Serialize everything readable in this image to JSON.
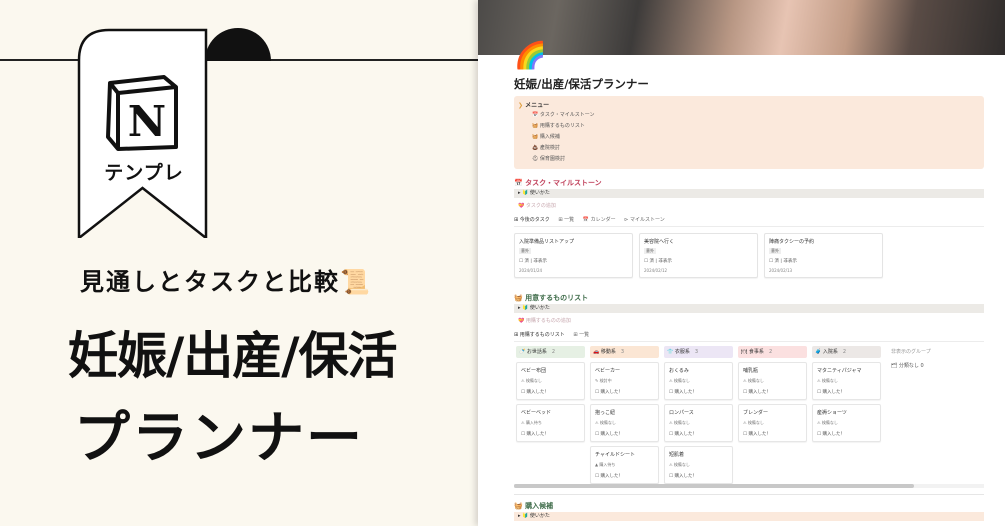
{
  "banner": {
    "logo_letter": "N",
    "ribbon_label": "テンプレ",
    "subtitle": "見通しとタスクと比較📜",
    "title_line1": "妊娠/出産/保活",
    "title_line2": "プランナー"
  },
  "notion": {
    "page_icon": "🌈",
    "page_title": "妊娠/出産/保活プランナー",
    "menu": {
      "title": "メニュー",
      "items": [
        "📅 タスク・マイルストーン",
        "🧺 用購するものリスト",
        "🧺 購入候補",
        "💩 產院検討",
        "⛑ 保育園検討"
      ]
    },
    "tasks": {
      "heading": "📅 タスク・マイルストーン",
      "toggle": "▸ 🔰 使いかた",
      "add_label": "💝 タスクの追加",
      "tabs": [
        "⊞ 今後のタスク",
        "⊞ 一覧",
        "📅 カレンダー",
        "⊳ マイルストーン"
      ],
      "cards": [
        {
          "title": "入院準備品リストアップ",
          "status": "意外",
          "check": "☐ 済 | 非表示",
          "date": "2024/01/24"
        },
        {
          "title": "美容院へ行く",
          "status": "意外",
          "check": "☐ 済 | 非表示",
          "date": "2024/02/12"
        },
        {
          "title": "陣痛タクシーの予約",
          "status": "意外",
          "check": "☐ 済 | 非表示",
          "date": "2024/02/13"
        }
      ]
    },
    "shopping": {
      "heading": "🧺 用意するものリスト",
      "toggle": "▸ 🔰 使いかた",
      "add_label": "💝 用購するものの追加",
      "tabs": [
        "⊞ 用購するものリスト",
        "⊞ 一覧"
      ],
      "columns": [
        {
          "label": "🍼 お世話系",
          "count": "2",
          "color": "#e6f0e4",
          "items": [
            {
              "title": "ベビー布団",
              "status": "⚠ 検備なし",
              "check": "☐ 購入した！"
            },
            {
              "title": "ベビーベッド",
              "status": "⚠ 購入待ち",
              "check": "☐ 購入した！"
            }
          ]
        },
        {
          "label": "🚗 移動系",
          "count": "3",
          "color": "#fbe6d4",
          "items": [
            {
              "title": "ベビーカー",
              "status": "✎ 検討中",
              "check": "☐ 購入した！"
            },
            {
              "title": "抱っこ紐",
              "status": "⚠ 検備なし",
              "check": "☐ 購入した！"
            },
            {
              "title": "チャイルドシート",
              "status": "▲ 購入待ち",
              "check": "☐ 購入した！"
            }
          ]
        },
        {
          "label": "👕 衣服系",
          "count": "3",
          "color": "#ece6f5",
          "items": [
            {
              "title": "おくるみ",
              "status": "⚠ 検備なし",
              "check": "☐ 購入した！"
            },
            {
              "title": "ロンパース",
              "status": "⚠ 検備なし",
              "check": "☐ 購入した！"
            },
            {
              "title": "短肌着",
              "status": "⚠ 検備なし",
              "check": "☐ 購入した！"
            }
          ]
        },
        {
          "label": "🍽 食事系",
          "count": "2",
          "color": "#fbe0e0",
          "items": [
            {
              "title": "哺乳瓶",
              "status": "⚠ 検備なし",
              "check": "☐ 購入した！"
            },
            {
              "title": "ブレンダー",
              "status": "⚠ 検備なし",
              "check": "☐ 購入した！"
            }
          ]
        },
        {
          "label": "🧳 入院系",
          "count": "2",
          "color": "#ece8e6",
          "items": [
            {
              "title": "マタニティパジャマ",
              "status": "⚠ 検備なし",
              "check": "☐ 購入した！"
            },
            {
              "title": "産褥ショーツ",
              "status": "⚠ 検備なし",
              "check": "☐ 購入した！"
            }
          ]
        }
      ],
      "hidden_group": "非表示のグループ",
      "hidden_item": "🗂 分類なし 0"
    },
    "candidates": {
      "heading": "🧺 購入候補",
      "toggle": "▸ 🔰 使いかた"
    }
  }
}
